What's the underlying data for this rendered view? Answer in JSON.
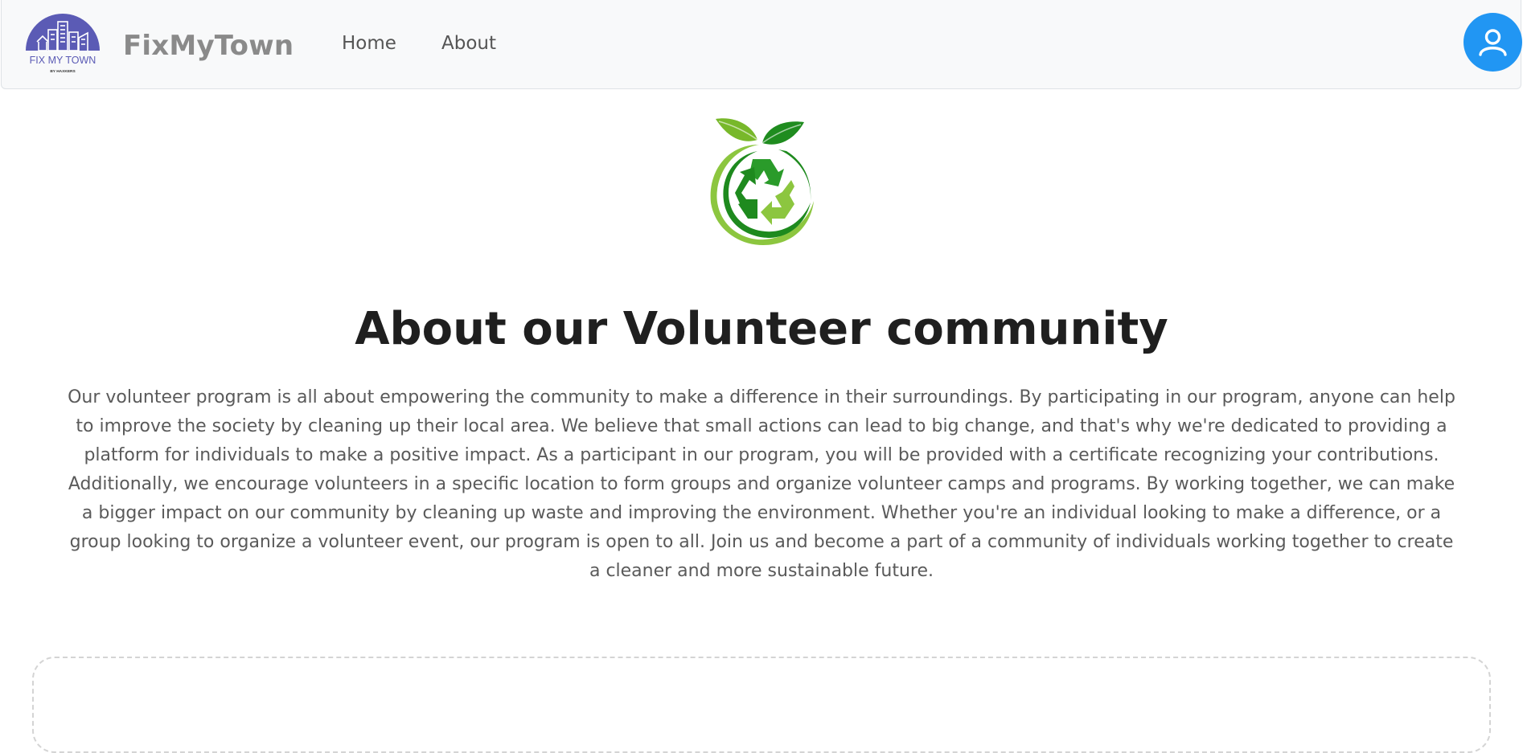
{
  "navbar": {
    "logo": {
      "text": "FIX MY TOWN",
      "subtext": "BY HAXKERS",
      "color": "#5b5bb5"
    },
    "brand": "FixMyTown",
    "links": [
      {
        "label": "Home"
      },
      {
        "label": "About"
      }
    ],
    "profile": {
      "icon": "user-icon",
      "color": "#2196f3"
    }
  },
  "hero": {
    "icon": "recycle-leaf-icon",
    "colors": {
      "dark_green": "#1e8a1e",
      "light_green": "#8cc63f"
    }
  },
  "about": {
    "title": "About our Volunteer community",
    "body": "Our volunteer program is all about empowering the community to make a difference in their surroundings. By participating in our program, anyone can help to improve the society by cleaning up their local area. We believe that small actions can lead to big change, and that's why we're dedicated to providing a platform for individuals to make a positive impact. As a participant in our program, you will be provided with a certificate recognizing your contributions. Additionally, we encourage volunteers in a specific location to form groups and organize volunteer camps and programs. By working together, we can make a bigger impact on our community by cleaning up waste and improving the environment. Whether you're an individual looking to make a difference, or a group looking to organize a volunteer event, our program is open to all. Join us and become a part of a community of individuals working together to create a cleaner and more sustainable future."
  }
}
